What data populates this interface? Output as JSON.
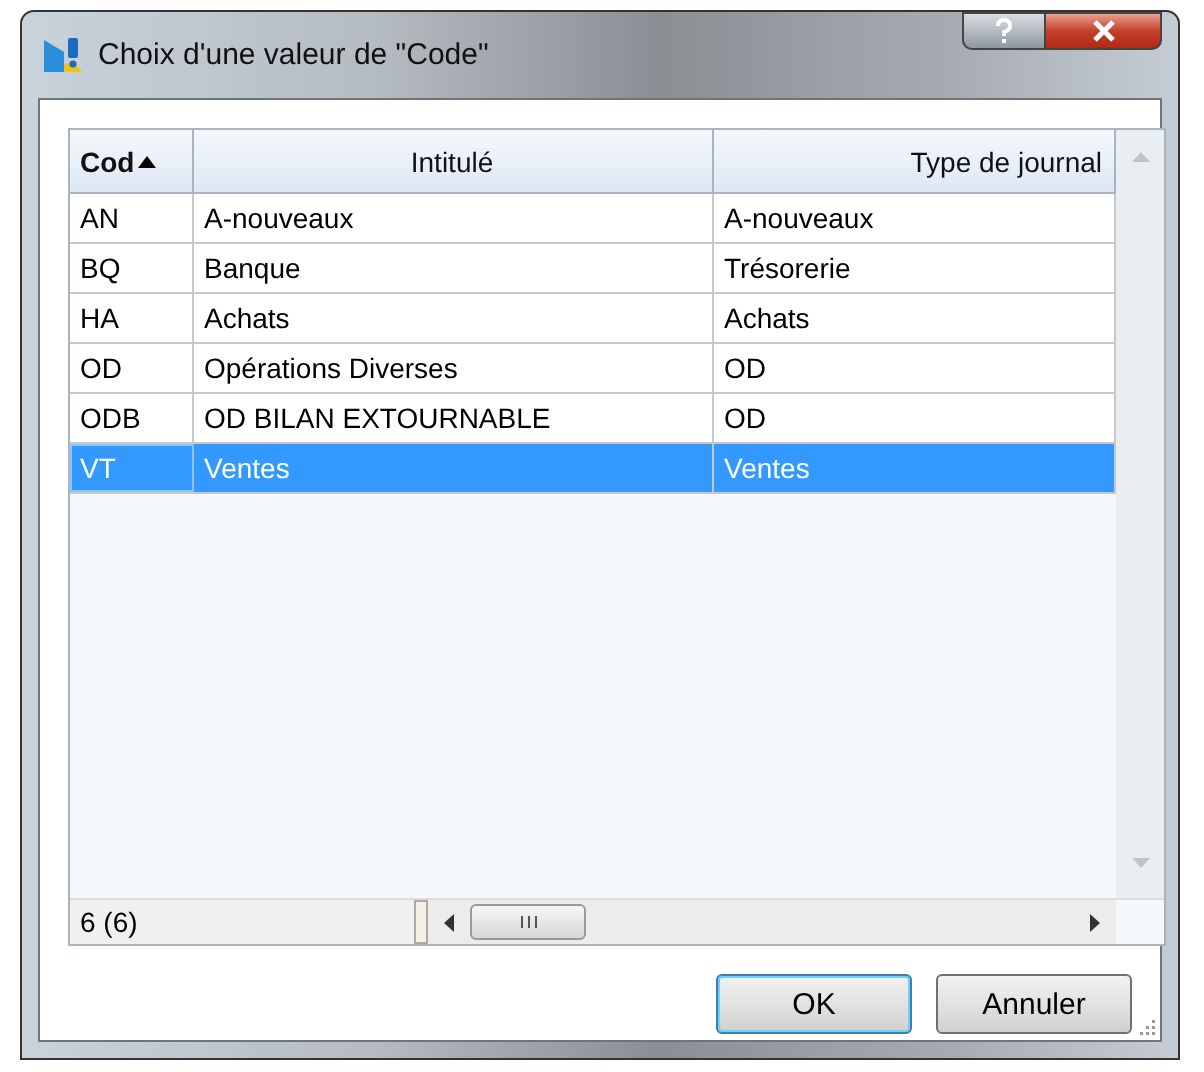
{
  "window": {
    "title": "Choix d'une valeur de \"Code\""
  },
  "table": {
    "columns": [
      {
        "label": "Cod",
        "sorted": true
      },
      {
        "label": "Intitulé",
        "sorted": false
      },
      {
        "label": "Type de journal",
        "sorted": false
      }
    ],
    "rows": [
      {
        "cells": [
          "AN",
          "A-nouveaux",
          "A-nouveaux"
        ],
        "selected": false
      },
      {
        "cells": [
          "BQ",
          "Banque",
          "Trésorerie"
        ],
        "selected": false
      },
      {
        "cells": [
          "HA",
          "Achats",
          "Achats"
        ],
        "selected": false
      },
      {
        "cells": [
          "OD",
          "Opérations Diverses",
          "OD"
        ],
        "selected": false
      },
      {
        "cells": [
          "ODB",
          "OD BILAN EXTOURNABLE",
          "OD"
        ],
        "selected": false
      },
      {
        "cells": [
          "VT",
          "Ventes",
          "Ventes"
        ],
        "selected": true
      }
    ]
  },
  "status": {
    "count": "6 (6)"
  },
  "buttons": [
    {
      "label": "OK",
      "default": true
    },
    {
      "label": "Annuler",
      "default": false
    }
  ]
}
